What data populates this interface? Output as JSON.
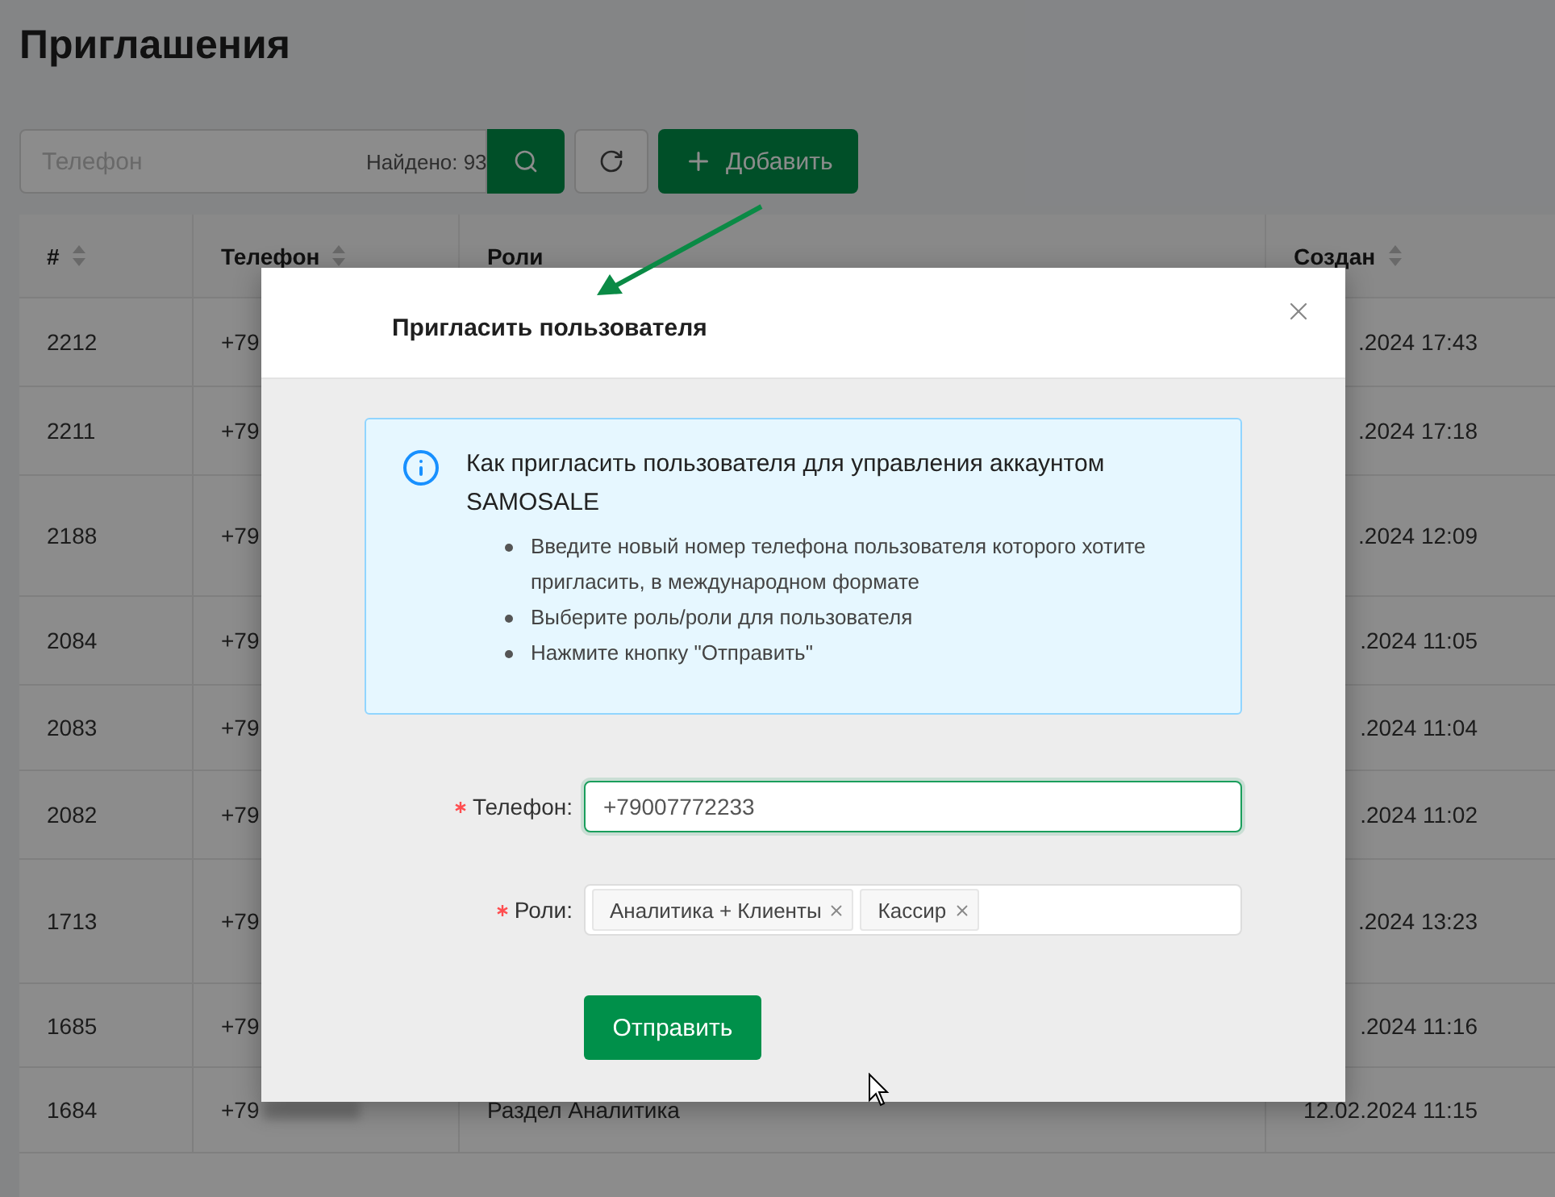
{
  "page": {
    "title": "Приглашения"
  },
  "toolbar": {
    "search": {
      "placeholder": "Телефон"
    },
    "found": "Найдено: 93",
    "add_label": "Добавить"
  },
  "table": {
    "columns": [
      {
        "label": "#",
        "sortable": true
      },
      {
        "label": "Телефон",
        "sortable": true
      },
      {
        "label": "Роли",
        "sortable": false
      },
      {
        "label": "Создан",
        "sortable": true
      }
    ],
    "rows": [
      {
        "id": "2212",
        "phone": "+79",
        "roles": "",
        "created": ".2024 17:43"
      },
      {
        "id": "2211",
        "phone": "+79",
        "roles": "",
        "created": ".2024 17:18"
      },
      {
        "id": "2188",
        "phone": "+79",
        "roles": "",
        "created": ".2024 12:09"
      },
      {
        "id": "2084",
        "phone": "+79",
        "roles": "",
        "created": ".2024 11:05"
      },
      {
        "id": "2083",
        "phone": "+79",
        "roles": "",
        "created": ".2024 11:04"
      },
      {
        "id": "2082",
        "phone": "+79",
        "roles": "",
        "created": ".2024 11:02"
      },
      {
        "id": "1713",
        "phone": "+79",
        "roles": "",
        "created": ".2024 13:23"
      },
      {
        "id": "1685",
        "phone": "+79",
        "roles": "",
        "created": ".2024 11:16"
      },
      {
        "id": "1684",
        "phone": "+79",
        "roles": "Раздел Аналитика",
        "created": "12.02.2024 11:15",
        "redacted": true
      }
    ]
  },
  "dialog": {
    "title": "Пригласить пользователя",
    "alert": {
      "title": "Как пригласить пользователя для управления аккаунтом SAMOSALE",
      "steps": [
        "Введите новый номер телефона пользователя которого хотите пригласить, в международном формате",
        "Выберите роль/роли для пользователя",
        "Нажмите кнопку \"Отправить\""
      ]
    },
    "fields": [
      {
        "kind": "input",
        "label": "Телефон:",
        "required": true,
        "value": "+79007772233",
        "focused": true
      },
      {
        "kind": "tags",
        "label": "Роли:",
        "required": true,
        "tags": [
          "Аналитика + Клиенты",
          "Кассир"
        ]
      }
    ],
    "submit": "Отправить"
  }
}
